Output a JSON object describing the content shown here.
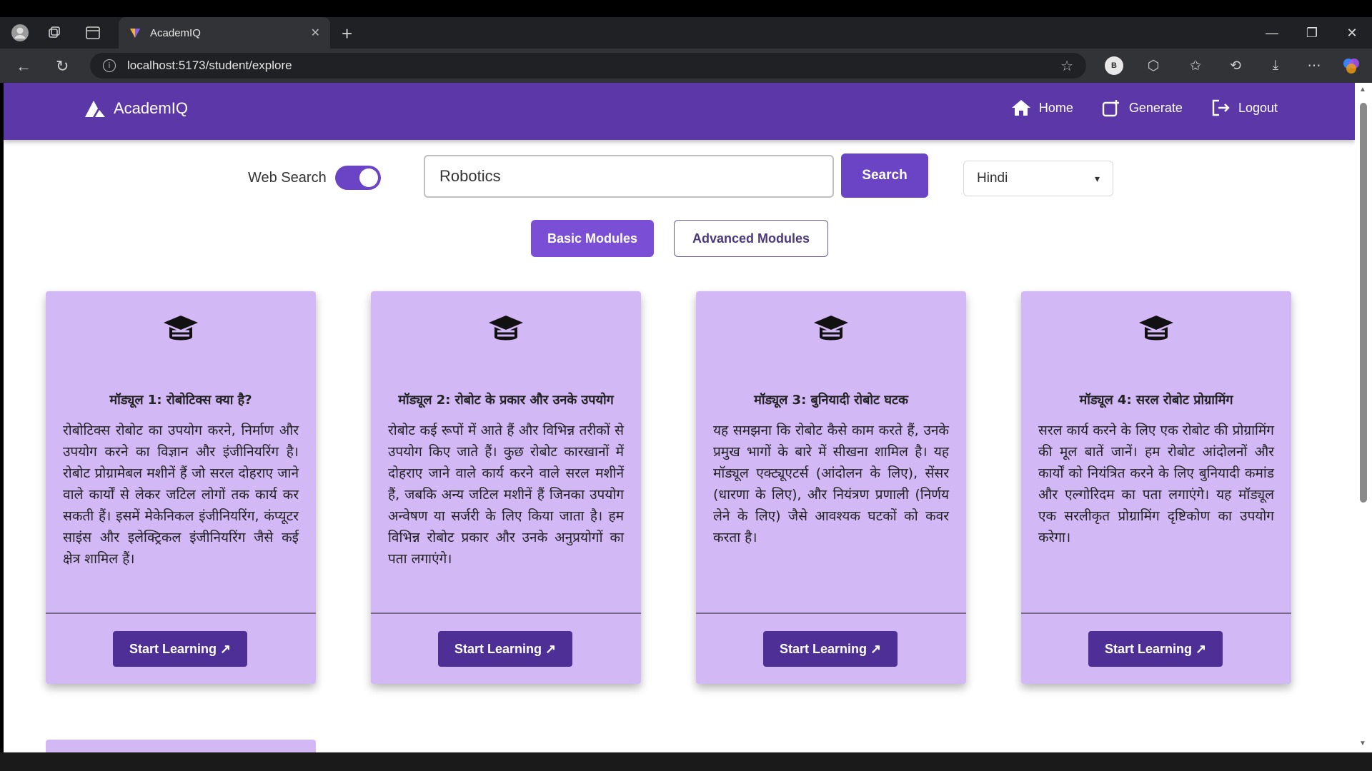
{
  "browser": {
    "tab_title": "AcademIQ",
    "url": "localhost:5173/student/explore",
    "profile_initial": "B"
  },
  "app": {
    "brand": "AcademIQ",
    "nav": {
      "home": "Home",
      "generate": "Generate",
      "logout": "Logout"
    },
    "web_search_label": "Web Search",
    "web_search_enabled": true,
    "search_value": "Robotics",
    "search_button": "Search",
    "language": "Hindi",
    "basic_modules": "Basic Modules",
    "advanced_modules": "Advanced Modules",
    "accent_color": "#5b37a8",
    "card_color": "#d3b8f6"
  },
  "modules": [
    {
      "title": "मॉड्यूल 1: रोबोटिक्स क्या है?",
      "description": "रोबोटिक्स रोबोट का उपयोग करने, निर्माण और उपयोग करने का विज्ञान और इंजीनियरिंग है। रोबोट प्रोग्रामेबल मशीनें हैं जो सरल दोहराए जाने वाले कार्यों से लेकर जटिल लोगों तक कार्य कर सकती हैं। इसमें मेकेनिकल इंजीनियरिंग, कंप्यूटर साइंस और इलेक्ट्रिकल इंजीनियरिंग जैसे कई क्षेत्र शामिल हैं।",
      "button": "Start Learning ↗"
    },
    {
      "title": "मॉड्यूल 2: रोबोट के प्रकार और उनके उपयोग",
      "description": "रोबोट कई रूपों में आते हैं और विभिन्न तरीकों से उपयोग किए जाते हैं। कुछ रोबोट कारखानों में दोहराए जाने वाले कार्य करने वाले सरल मशीनें हैं, जबकि अन्य जटिल मशीनें हैं जिनका उपयोग अन्वेषण या सर्जरी के लिए किया जाता है। हम विभिन्न रोबोट प्रकार और उनके अनुप्रयोगों का पता लगाएंगे।",
      "button": "Start Learning ↗"
    },
    {
      "title": "मॉड्यूल 3: बुनियादी रोबोट घटक",
      "description": "यह समझना कि रोबोट कैसे काम करते हैं, उनके प्रमुख भागों के बारे में सीखना शामिल है। यह मॉड्यूल एक्ट्यूएटर्स (आंदोलन के लिए), सेंसर (धारणा के लिए), और नियंत्रण प्रणाली (निर्णय लेने के लिए) जैसे आवश्यक घटकों को कवर करता है।",
      "button": "Start Learning ↗"
    },
    {
      "title": "मॉड्यूल 4: सरल रोबोट प्रोग्रामिंग",
      "description": "सरल कार्य करने के लिए एक रोबोट की प्रोग्रामिंग की मूल बातें जानें। हम रोबोट आंदोलनों और कार्यों को नियंत्रित करने के लिए बुनियादी कमांड और एल्गोरिदम का पता लगाएंगे। यह मॉड्यूल एक सरलीकृत प्रोग्रामिंग दृष्टिकोण का उपयोग करेगा।",
      "button": "Start Learning ↗"
    }
  ]
}
